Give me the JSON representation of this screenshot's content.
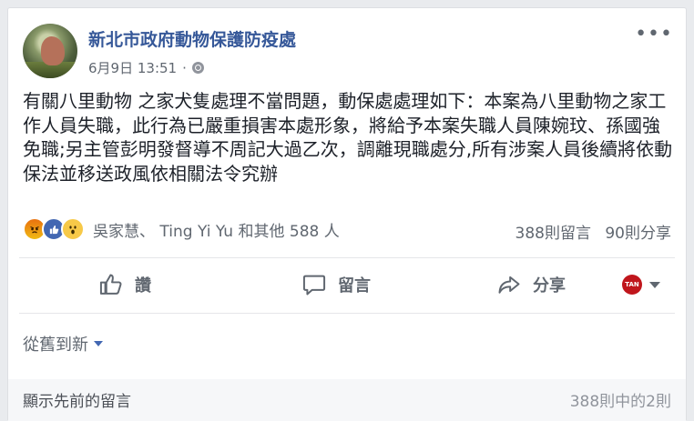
{
  "post": {
    "page_name": "新北市政府動物保護防疫處",
    "timestamp": "6月9日 13:51",
    "separator": "·",
    "privacy_icon": "globe-icon",
    "more_icon": "more-dots-icon",
    "more_label": "•••",
    "text": "有關八里動物 之家犬隻處理不當問題，動保處處理如下：本案為八里動物之家工作人員失職，此行為已嚴重損害本處形象，將給予本案失職人員陳婉玟、孫國強免職;另主管彭明發督導不周記大過乙次，調離現職處分,所有涉案人員後續將依動保法並移送政風依相關法令究辦"
  },
  "reactions": {
    "icons": [
      "angry-icon",
      "like-icon",
      "wow-icon"
    ],
    "reactors": "吳家慧、 Ting Yi Yu 和其他 588 人",
    "comments": "388則留言",
    "shares": "90則分享"
  },
  "actions": {
    "like": "讚",
    "comment": "留言",
    "share": "分享",
    "page_avatar_text": "TAN"
  },
  "comments": {
    "sort_label": "從舊到新",
    "view_previous": "顯示先前的留言",
    "count": "388則中的2則"
  },
  "colors": {
    "link": "#365899",
    "secondary": "#606770",
    "background": "#e9ebee",
    "accent": "#4267b2"
  }
}
